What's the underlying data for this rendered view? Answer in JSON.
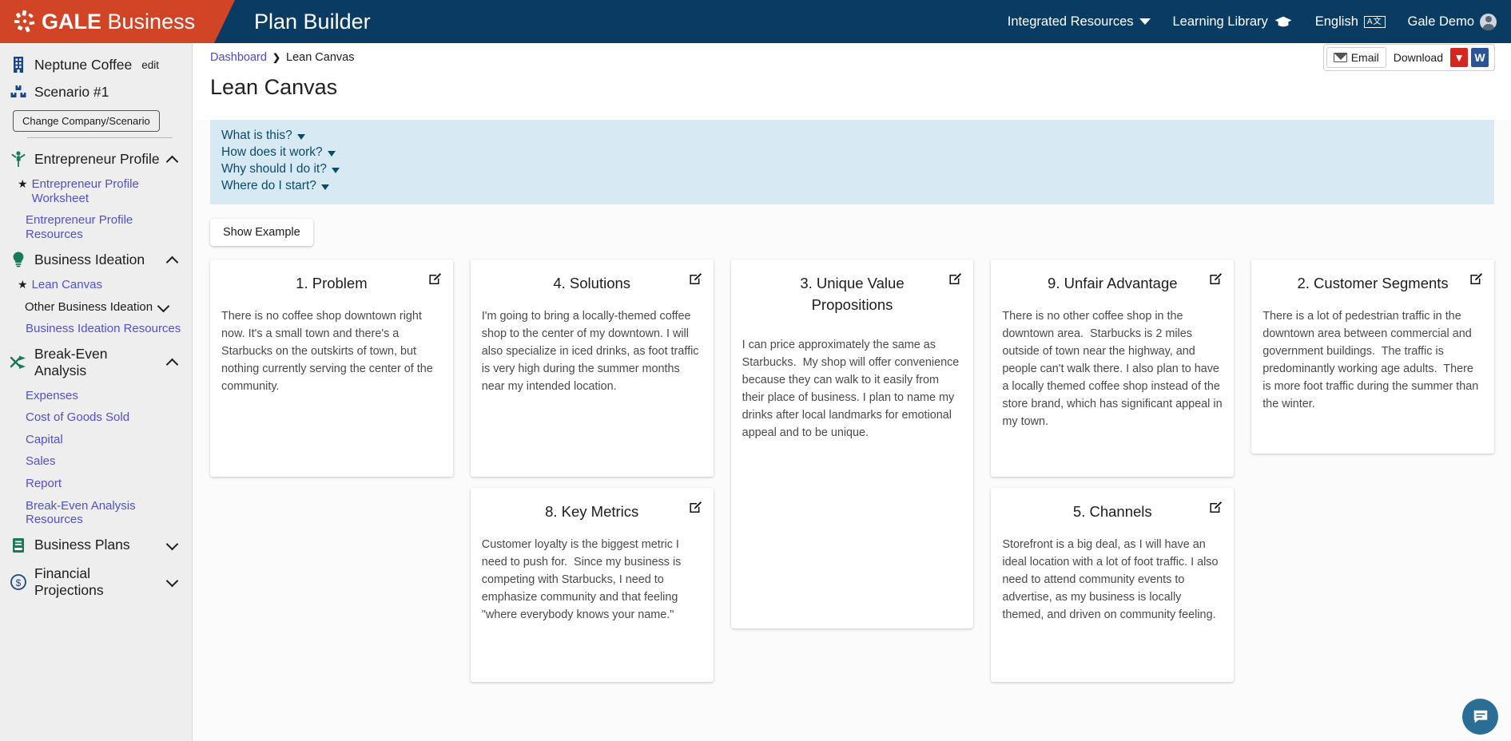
{
  "brand": {
    "name_bold": "GALE",
    "name_light": "Business",
    "app_title": "Plan Builder",
    "logo_icon": "gale-starburst-icon",
    "orange": "#d14425",
    "navy": "#0a3c63"
  },
  "topnav": {
    "integrated_resources": "Integrated Resources",
    "learning_library": "Learning Library",
    "language": "English",
    "user": "Gale Demo",
    "icons": {
      "integrated_chevron": "chevron-down-icon",
      "learning_cap": "graduation-cap-icon",
      "language": "translate-icon",
      "user": "user-avatar-icon"
    }
  },
  "sidebar": {
    "company": {
      "name": "Neptune Coffee",
      "edit": "edit",
      "icon": "building-icon"
    },
    "scenario": {
      "name": "Scenario #1",
      "icon": "scenario-boxes-icon"
    },
    "change_button": "Change Company/Scenario",
    "groups": [
      {
        "label": "Entrepreneur Profile",
        "icon": "person-raised-arms-icon",
        "state": "expanded",
        "links": [
          {
            "label": "Entrepreneur Profile Worksheet",
            "starred": true
          },
          {
            "label": "Entrepreneur Profile Resources",
            "starred": false
          }
        ]
      },
      {
        "label": "Business Ideation",
        "icon": "lightbulb-icon",
        "state": "expanded",
        "links": [
          {
            "label": "Lean Canvas",
            "starred": true
          },
          {
            "label": "Other Business Ideation",
            "starred": false,
            "sub": true,
            "caret": "down"
          },
          {
            "label": "Business Ideation Resources",
            "starred": false
          }
        ]
      },
      {
        "label": "Break-Even Analysis",
        "icon": "shuffle-arrows-icon",
        "state": "expanded",
        "links": [
          {
            "label": "Expenses",
            "starred": false
          },
          {
            "label": "Cost of Goods Sold",
            "starred": false
          },
          {
            "label": "Capital",
            "starred": false
          },
          {
            "label": "Sales",
            "starred": false
          },
          {
            "label": "Report",
            "starred": false
          },
          {
            "label": "Break-Even Analysis Resources",
            "starred": false
          }
        ]
      },
      {
        "label": "Business Plans",
        "icon": "book-icon",
        "state": "collapsed",
        "links": []
      },
      {
        "label": "Financial Projections",
        "icon": "dollar-circle-icon",
        "state": "collapsed",
        "links": []
      }
    ]
  },
  "main": {
    "breadcrumb": {
      "root": "Dashboard",
      "separator": "❯",
      "current": "Lean Canvas"
    },
    "page_title": "Lean Canvas",
    "actions": {
      "email": "Email",
      "download": "Download",
      "pdf_label": "PDF",
      "word_label": "W",
      "email_icon": "envelope-icon",
      "pdf_icon": "pdf-file-icon",
      "word_icon": "word-file-icon"
    },
    "info_questions": [
      "What is this?",
      "How does it work?",
      "Why should I do it?",
      "Where do I start?"
    ],
    "show_example": "Show Example",
    "chat_icon": "chat-bubble-icon"
  },
  "cards": {
    "problem": {
      "title": "1. Problem",
      "body": "There is no coffee shop downtown right now. It's a small town and there's a Starbucks on the outskirts of town, but nothing currently serving the center of the community."
    },
    "solutions": {
      "title": "4. Solutions",
      "body": "I'm going to bring a locally-themed coffee shop to the center of my downtown. I will also specialize in iced drinks, as foot traffic is very high during the summer months near my intended location."
    },
    "uvp": {
      "title": "3. Unique Value Propositions",
      "body": "I can price approximately the same as Starbucks.  My shop will offer convenience because they can walk to it easily from their place of business. I plan to name my drinks after local landmarks for emotional appeal and to be unique."
    },
    "unfair": {
      "title": "9. Unfair Advantage",
      "body": "There is no other coffee shop in the downtown area.  Starbucks is 2 miles outside of town near the highway, and people can't walk there. I also plan to have a locally themed coffee shop instead of the store brand, which has significant appeal in my town."
    },
    "segments": {
      "title": "2. Customer Segments",
      "body": "There is a lot of pedestrian traffic in the downtown area between commercial and government buildings.  The traffic is predominantly working age adults.  There is more foot traffic during the summer than the winter."
    },
    "metrics": {
      "title": "8. Key Metrics",
      "body": "Customer loyalty is the biggest metric I need to push for.  Since my business is competing with Starbucks, I need to emphasize community and that feeling \"where everybody knows your name.\""
    },
    "channels": {
      "title": "5. Channels",
      "body": "Storefront is a big deal, as I will have an ideal location with a lot of foot traffic. I also need to attend community events to advertise, as my business is locally themed, and driven on community feeling."
    },
    "edit_icon": "edit-pencil-icon"
  }
}
